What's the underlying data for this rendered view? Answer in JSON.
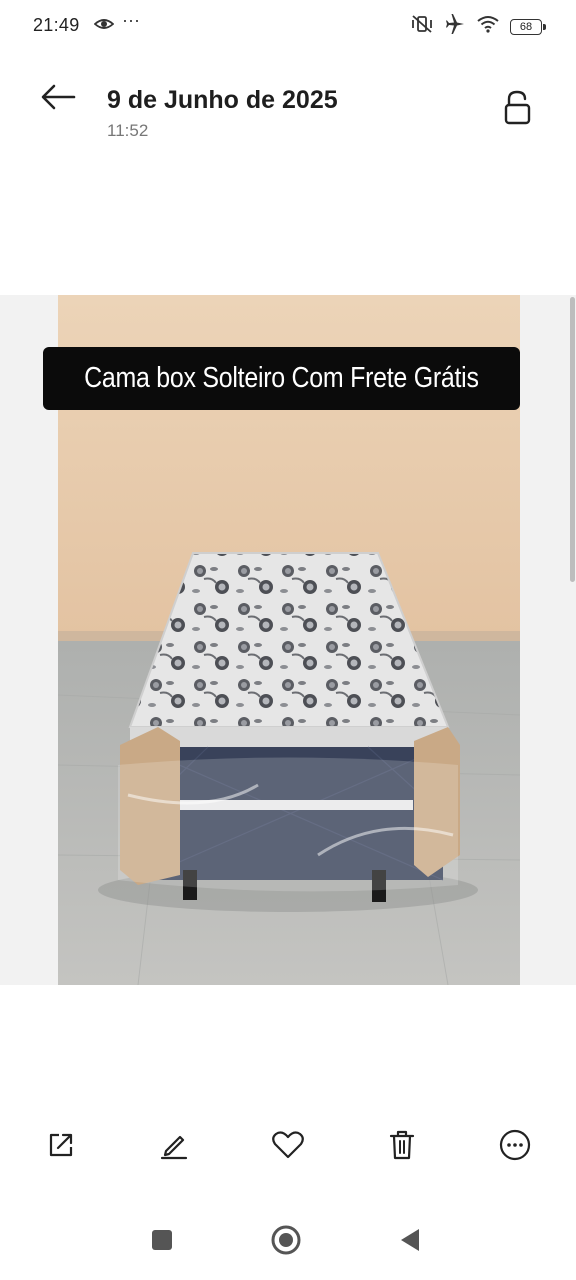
{
  "status_bar": {
    "time": "21:49",
    "battery_level": "68",
    "left_icons": [
      "eye-icon",
      "more-dots"
    ],
    "right_icons": [
      "vibrate-off-icon",
      "airplane-icon",
      "wifi-icon",
      "battery-icon"
    ],
    "dots": "···"
  },
  "header": {
    "title": "9 de Junho de 2025",
    "subtitle": "11:52"
  },
  "photo": {
    "caption": "Cama box Solteiro Com Frete Grátis"
  },
  "toolbar": {
    "items": [
      "share-icon",
      "edit-icon",
      "favorite-icon",
      "delete-icon",
      "more-icon"
    ]
  },
  "navbar": {
    "items": [
      "recent-apps",
      "home",
      "back"
    ]
  },
  "colors": {
    "caption_bg": "#0b0b0b",
    "wall": "#e9cfb1",
    "floor": "#b7b7b3",
    "box_base": "#3a4457"
  }
}
